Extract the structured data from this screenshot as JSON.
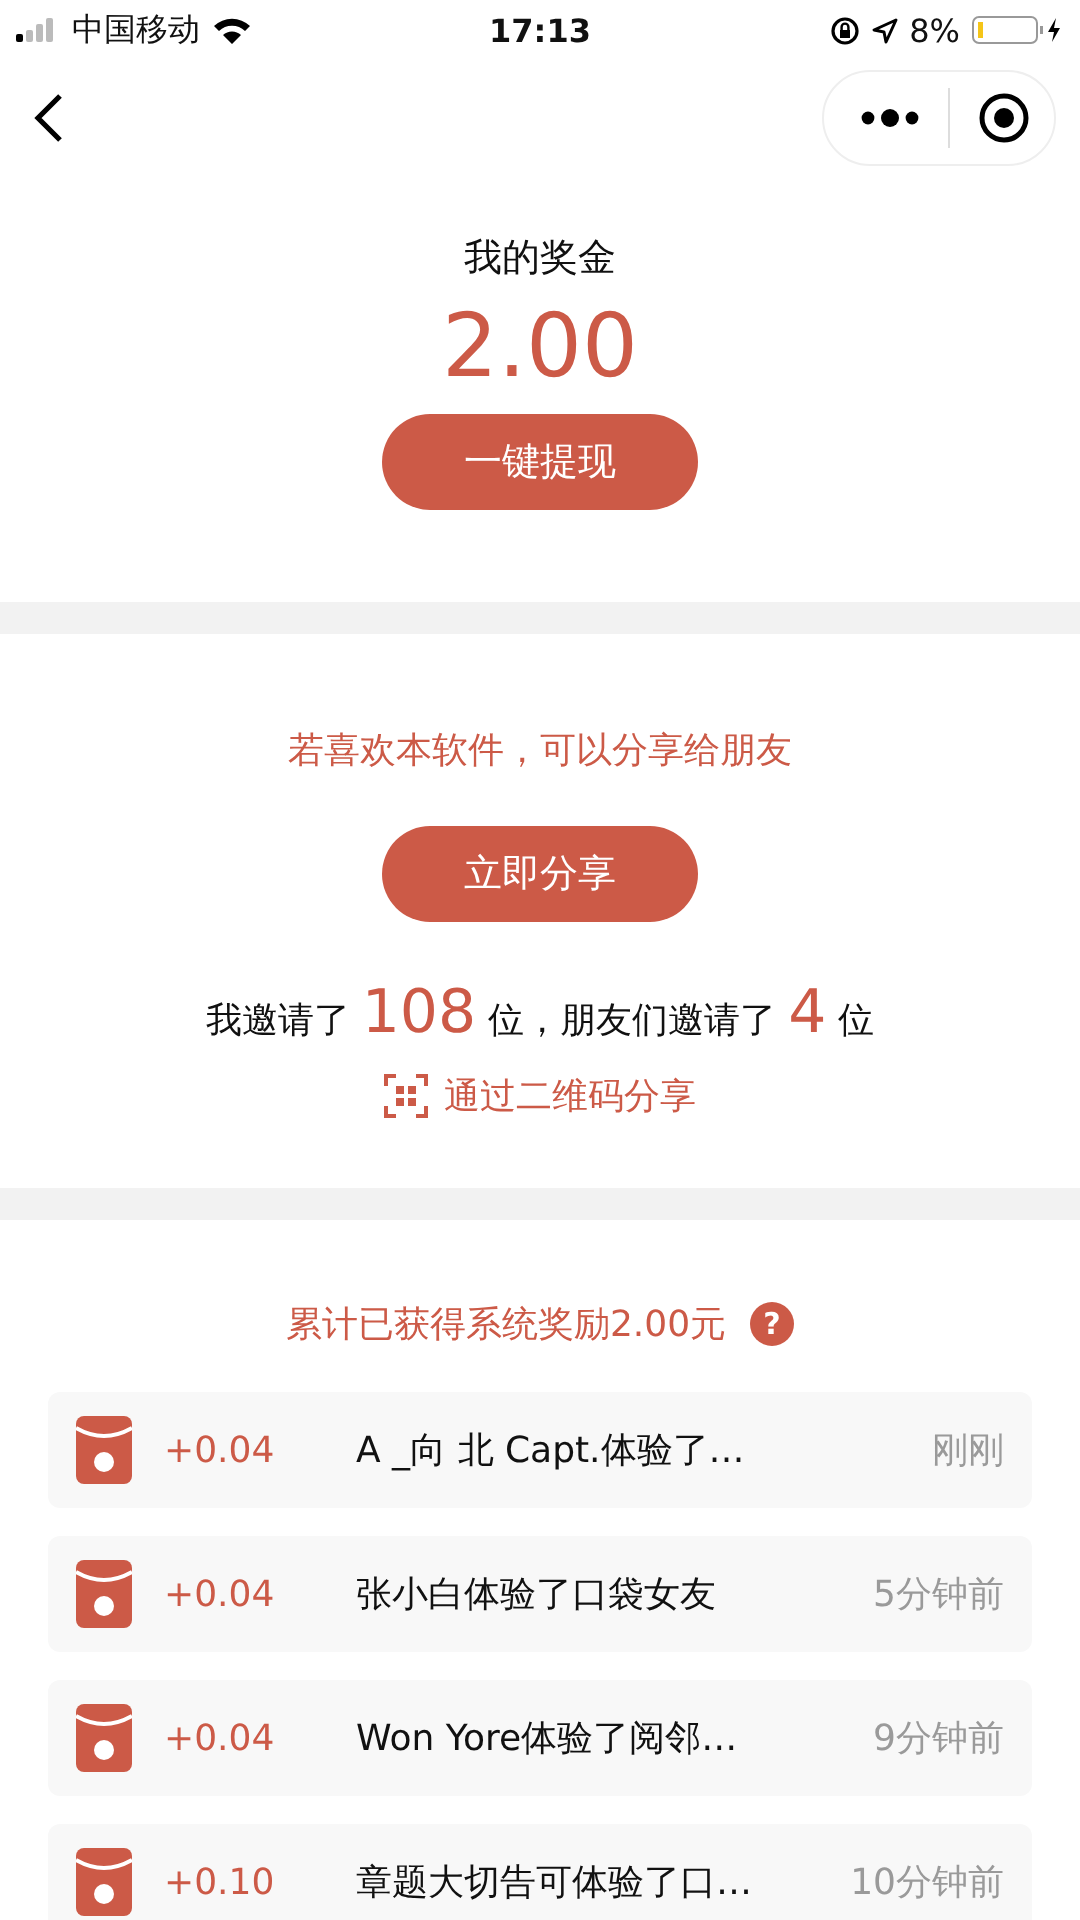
{
  "status_bar": {
    "carrier": "中国移动",
    "time": "17:13",
    "battery": "8%"
  },
  "bonus": {
    "title": "我的奖金",
    "amount": "2.00",
    "withdraw_button": "一键提现"
  },
  "share": {
    "prompt": "若喜欢本软件，可以分享给朋友",
    "share_button": "立即分享",
    "invite_parts": [
      {
        "text": "我邀请了",
        "kind": "plain"
      },
      {
        "text": "108",
        "kind": "number"
      },
      {
        "text": "位，朋友们邀请了",
        "kind": "plain"
      },
      {
        "text": "4",
        "kind": "number"
      },
      {
        "text": "位",
        "kind": "plain"
      }
    ],
    "qr_link": "通过二维码分享"
  },
  "rewards": {
    "heading": "累计已获得系统奖励2.00元",
    "help": "?",
    "rows": [
      {
        "amount": "+0.04",
        "text": "A _向 北 Capt.体验了…",
        "time": "刚刚"
      },
      {
        "amount": "+0.04",
        "text": "张小白体验了口袋女友",
        "time": "5分钟前"
      },
      {
        "amount": "+0.04",
        "text": "Won Yore体验了阅邻…",
        "time": "9分钟前"
      },
      {
        "amount": "+0.10",
        "text": "章题大切告可体验了口…",
        "time": "10分钟前"
      }
    ]
  }
}
